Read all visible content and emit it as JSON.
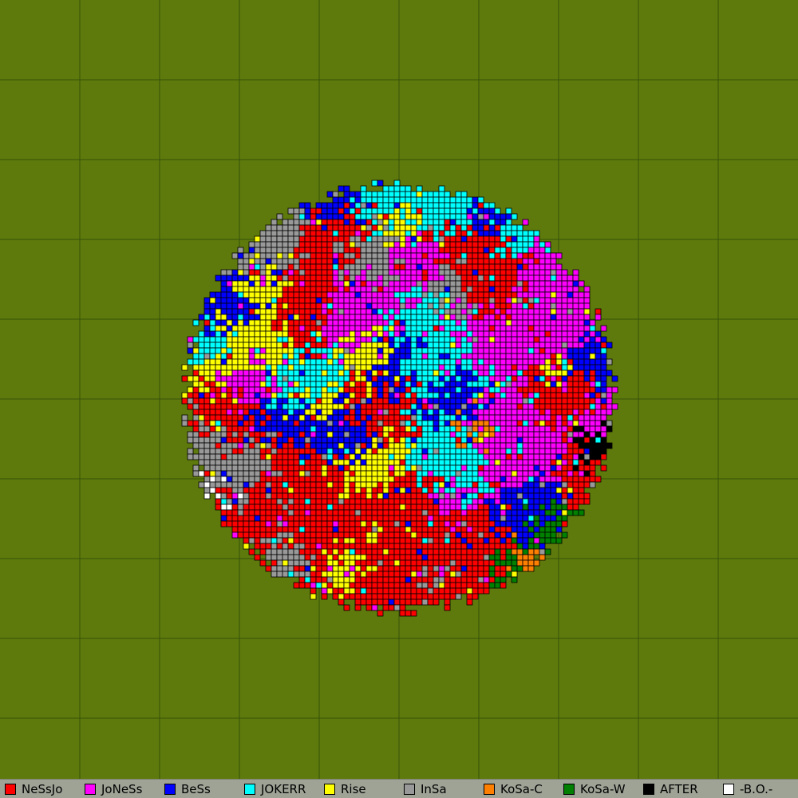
{
  "map": {
    "background_color": "#5f7a0c",
    "grid_color": "#36510a",
    "territory_border_color": "#000000"
  },
  "legend": [
    {
      "name": "NeSsJo",
      "color": "#ff0000"
    },
    {
      "name": "JoNeSs",
      "color": "#ff00ff"
    },
    {
      "name": "BeSs",
      "color": "#0000ff"
    },
    {
      "name": "JOKERR",
      "color": "#00ffff"
    },
    {
      "name": "Rise",
      "color": "#ffff00"
    },
    {
      "name": "InSa",
      "color": "#999999"
    },
    {
      "name": "KoSa-C",
      "color": "#ff7f00"
    },
    {
      "name": "KoSa-W",
      "color": "#007f00"
    },
    {
      "name": "AFTER",
      "color": "#000000"
    },
    {
      "name": "-B.O.-",
      "color": "#ffffff"
    }
  ]
}
